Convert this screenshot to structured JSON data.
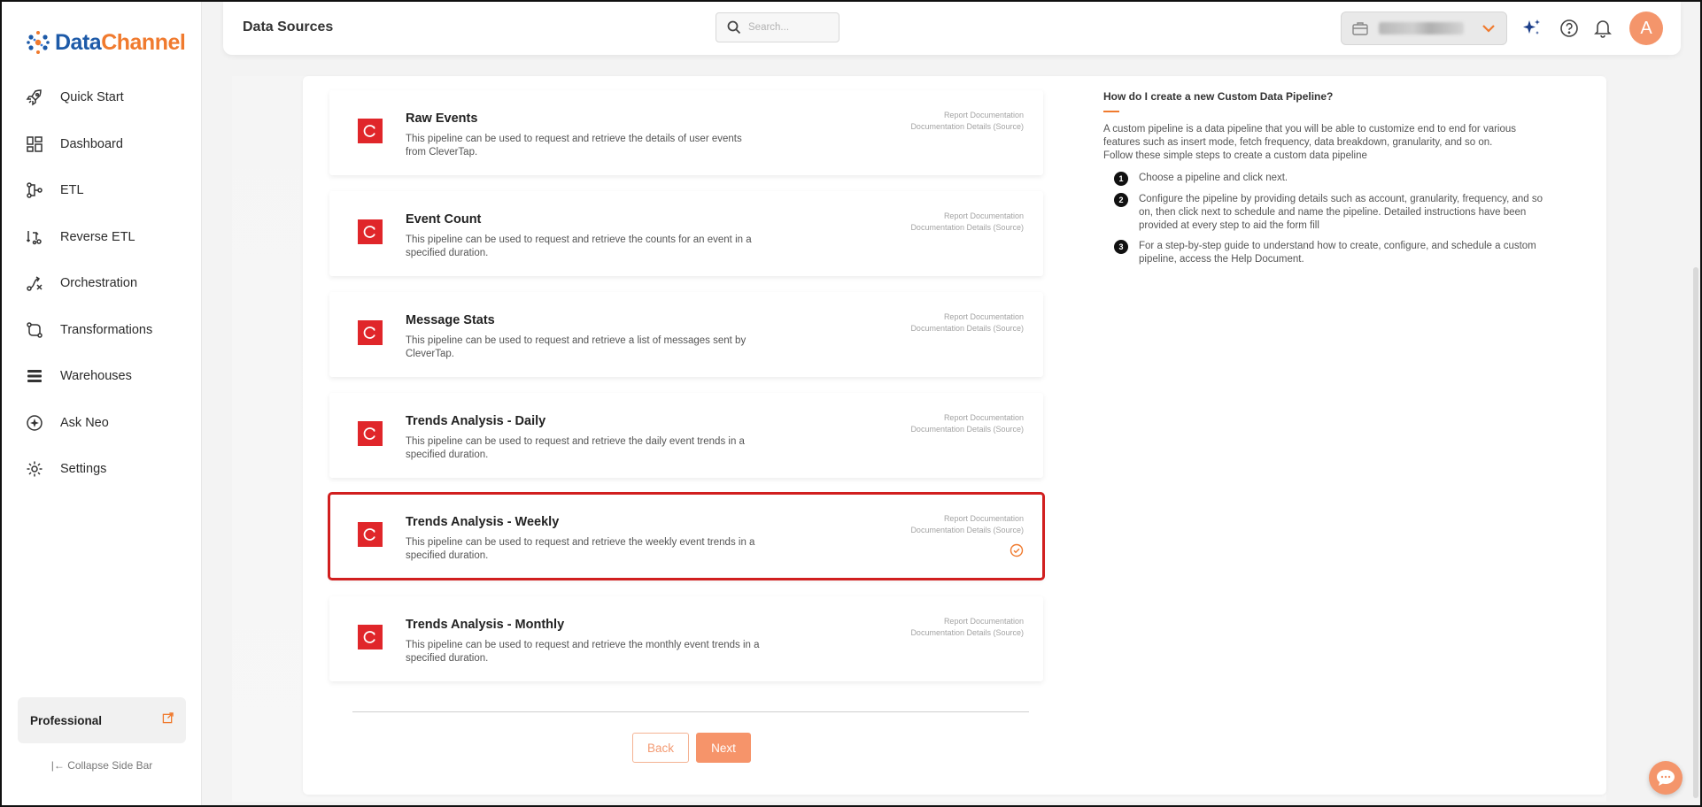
{
  "brand": {
    "part1": "Data",
    "part2": "Channel"
  },
  "sidebar": {
    "items": [
      {
        "label": "Quick Start",
        "icon": "rocket-icon"
      },
      {
        "label": "Dashboard",
        "icon": "dashboard-icon"
      },
      {
        "label": "ETL",
        "icon": "etl-icon"
      },
      {
        "label": "Reverse ETL",
        "icon": "reverse-etl-icon"
      },
      {
        "label": "Orchestration",
        "icon": "orchestration-icon"
      },
      {
        "label": "Transformations",
        "icon": "transformations-icon"
      },
      {
        "label": "Warehouses",
        "icon": "warehouses-icon"
      },
      {
        "label": "Ask Neo",
        "icon": "sparkle-icon"
      },
      {
        "label": "Settings",
        "icon": "gear-icon"
      }
    ],
    "plan": "Professional",
    "collapse": "Collapse Side Bar"
  },
  "header": {
    "title": "Data Sources",
    "search_placeholder": "Search...",
    "avatar_initial": "A"
  },
  "cards": [
    {
      "title": "Raw Events",
      "desc": "This pipeline can be used to request and retrieve the details of user events from CleverTap.",
      "link1": "Report Documentation",
      "link2": "Documentation Details (Source)",
      "selected": false
    },
    {
      "title": "Event Count",
      "desc": "This pipeline can be used to request and retrieve the counts for an event in a specified duration.",
      "link1": "Report Documentation",
      "link2": "Documentation Details (Source)",
      "selected": false
    },
    {
      "title": "Message Stats",
      "desc": "This pipeline can be used to request and retrieve a list of messages sent by CleverTap.",
      "link1": "Report Documentation",
      "link2": "Documentation Details (Source)",
      "selected": false
    },
    {
      "title": "Trends Analysis - Daily",
      "desc": "This pipeline can be used to request and retrieve the daily event trends in a specified duration.",
      "link1": "Report Documentation",
      "link2": "Documentation Details (Source)",
      "selected": false
    },
    {
      "title": "Trends Analysis - Weekly",
      "desc": "This pipeline can be used to request and retrieve the weekly event trends in a specified duration.",
      "link1": "Report Documentation",
      "link2": "Documentation Details (Source)",
      "selected": true
    },
    {
      "title": "Trends Analysis - Monthly",
      "desc": "This pipeline can be used to request and retrieve the monthly event trends in a specified duration.",
      "link1": "Report Documentation",
      "link2": "Documentation Details (Source)",
      "selected": false
    }
  ],
  "buttons": {
    "back": "Back",
    "next": "Next"
  },
  "help": {
    "title": "How do I create a new Custom Data Pipeline?",
    "para1": "A custom pipeline is a data pipeline that you will be able to customize end to end for various features such as insert mode, fetch frequency, data breakdown, granularity, and so on.",
    "para2": "Follow these simple steps to create a custom data pipeline",
    "steps": [
      {
        "num": "1",
        "text": "Choose a pipeline and click next."
      },
      {
        "num": "2",
        "text": "Configure the pipeline by providing details such as account, granularity, frequency, and so on, then click next to schedule and name the pipeline. Detailed instructions have been provided at every step to aid the form fill"
      },
      {
        "num": "3",
        "text": "For a step-by-step guide to understand how to create, configure, and schedule a custom pipeline, access the Help Document."
      }
    ]
  },
  "colors": {
    "accent": "#f07a2e",
    "brand_blue": "#1d5aa8",
    "clevertap_red": "#e0262a",
    "selected_outline": "#d11f1f"
  }
}
